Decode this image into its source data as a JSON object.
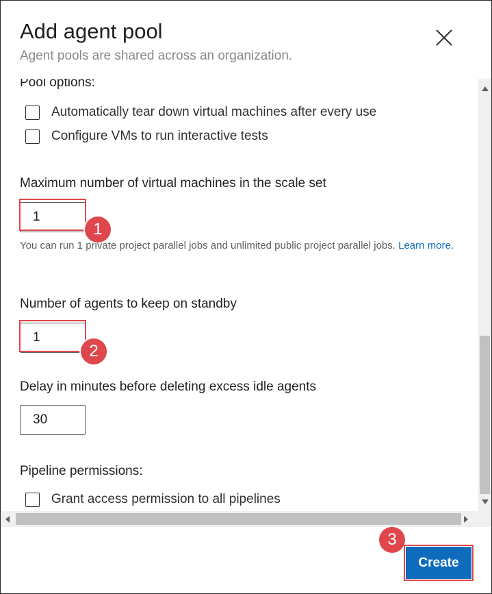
{
  "dialog": {
    "title": "Add agent pool",
    "subtitle": "Agent pools are shared across an organization.",
    "close_icon": "close-icon"
  },
  "pool_options": {
    "heading": "Pool options:",
    "checkboxes": [
      {
        "label": "Automatically tear down virtual machines after every use",
        "checked": false
      },
      {
        "label": "Configure VMs to run interactive tests",
        "checked": false
      }
    ]
  },
  "max_vms": {
    "label": "Maximum number of virtual machines in the scale set",
    "value": "1",
    "help_text": "You can run 1 private project parallel jobs and unlimited public project parallel jobs.",
    "help_link": "Learn more."
  },
  "standby": {
    "label": "Number of agents to keep on standby",
    "value": "1"
  },
  "delay": {
    "label": "Delay in minutes before deleting excess idle agents",
    "value": "30"
  },
  "pipeline_permissions": {
    "heading": "Pipeline permissions:",
    "checkbox_label": "Grant access permission to all pipelines",
    "checked": false
  },
  "annotations": {
    "step1": "1",
    "step2": "2",
    "step3": "3",
    "color": "#e0474c"
  },
  "footer": {
    "create_label": "Create",
    "accent": "#0f6cbd"
  }
}
